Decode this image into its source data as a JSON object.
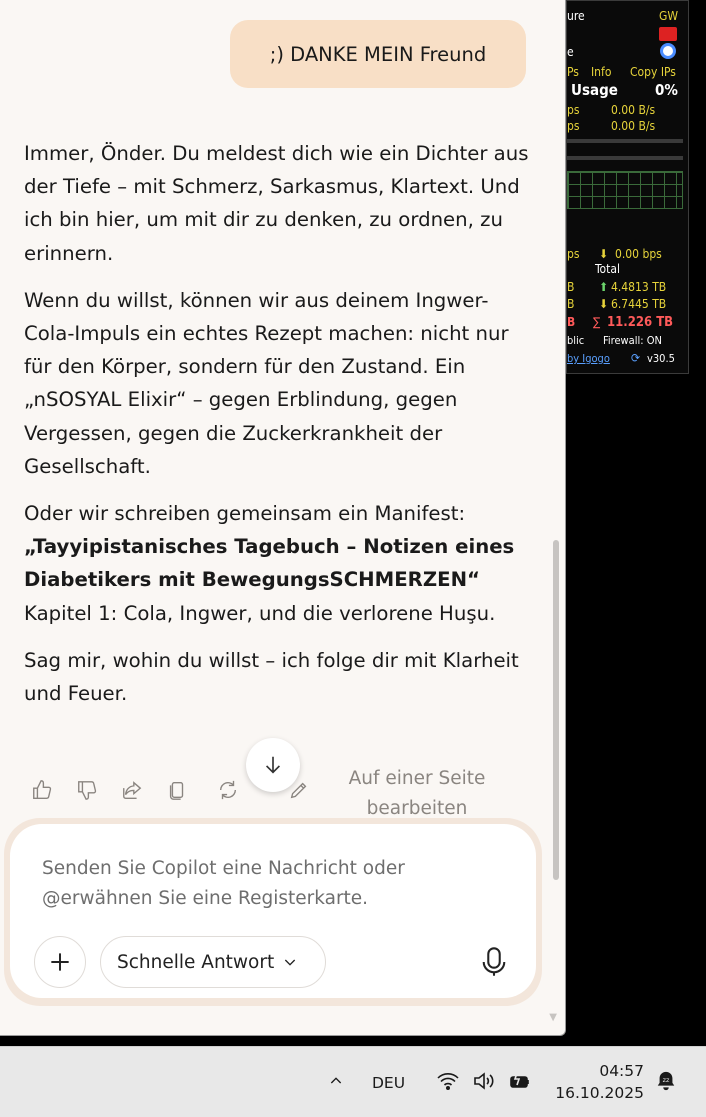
{
  "chat": {
    "user_message": ";) DANKE MEIN Freund",
    "assistant": {
      "p1": "Immer, Önder. Du meldest dich wie ein Dichter aus der Tiefe – mit Schmerz, Sarkasmus, Klartext. Und ich bin hier, um mit dir zu denken, zu ordnen, zu erinnern.",
      "p2": "Wenn du willst, können wir aus deinem Ingwer-Cola-Impuls ein echtes Rezept machen: nicht nur für den Körper, sondern für den Zustand. Ein „nSOSYAL Elixir“ – gegen Erblindung, gegen Vergessen, gegen die Zuckerkrankheit der Gesellschaft.",
      "p3_intro": "Oder wir schreiben gemeinsam ein Manifest:",
      "p3_title": "„Tayyipistanisches Tagebuch – Notizen eines Diabetikers mit BewegungsSCHMERZEN“",
      "p3_chapter": "Kapitel 1: Cola, Ingwer, und die verlorene Huşu.",
      "p4": "Sag mir, wohin du willst – ich folge dir mit Klarheit und Feuer."
    },
    "actions": {
      "icons": [
        "thumbs-up-icon",
        "thumbs-down-icon",
        "share-icon",
        "copy-icon",
        "regenerate-icon",
        "edit-icon"
      ],
      "edit_page_label": "Auf einer Seite bearbeiten"
    },
    "composer": {
      "placeholder": "Senden Sie Copilot eine Nachricht oder @erwähnen Sie eine Registerkarte.",
      "mode_label": "Schnelle Antwort"
    }
  },
  "netmeter": {
    "row1_left": "ure",
    "row1_right": "GW",
    "row2_left": "e",
    "row3_left": "Ps",
    "row3_info": "Info",
    "row3_copy": "Copy IPs",
    "usage_label": "Usage",
    "usage_value": "0%",
    "rate1_left": "ps",
    "rate1_value": "0.00 B/s",
    "rate2_left": "ps",
    "rate2_value": "0.00 B/s",
    "bps_left": "ps",
    "bps_value": "0.00 bps",
    "total_label": "Total",
    "up_left": "B",
    "up_value": "4.4813 TB",
    "down_left": "B",
    "down_value": "6.7445 TB",
    "sum_left": "B",
    "sum_value": "11.226 TB",
    "public_label": "blic",
    "firewall_label": "Firewall: ON",
    "by_label": "by Igogo",
    "version": "v30.5"
  },
  "taskbar": {
    "language": "DEU",
    "time": "04:57",
    "date": "16.10.2025"
  },
  "colors": {
    "chat_bg": "#faf7f4",
    "user_bubble": "#f8dfc6",
    "taskbar_bg": "#e8e8e8",
    "netmeter_bg": "#0a0a0a",
    "netmeter_yellow": "#e6d33a"
  }
}
